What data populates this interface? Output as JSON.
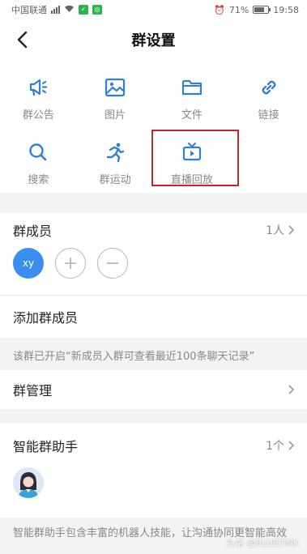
{
  "status_bar": {
    "carrier": "中国联通",
    "alarm": "⏰",
    "battery": "71%",
    "battery_level": 0.71,
    "time": "19:58"
  },
  "navbar": {
    "title": "群设置"
  },
  "features": [
    {
      "label": "群公告",
      "icon": "megaphone-icon"
    },
    {
      "label": "图片",
      "icon": "image-icon"
    },
    {
      "label": "文件",
      "icon": "folder-icon"
    },
    {
      "label": "链接",
      "icon": "link-icon"
    },
    {
      "label": "搜索",
      "icon": "search-icon"
    },
    {
      "label": "群运动",
      "icon": "running-icon"
    },
    {
      "label": "直播回放",
      "icon": "tv-icon"
    }
  ],
  "members": {
    "title": "群成员",
    "count": "1人",
    "user_initials": "xy"
  },
  "add_members": {
    "label": "添加群成员",
    "notice": "该群已开启“新成员入群可查看最近100条聊天记录”"
  },
  "manage": {
    "label": "群管理"
  },
  "assistant": {
    "title": "智能群助手",
    "count": "1个",
    "description": "智能群助手包含丰富的机器人技能，让沟通协同更智能高效"
  },
  "watermark": "头条 @BLUEPINK",
  "colors": {
    "accent": "#2f7fd8",
    "highlight_border": "#c0272d",
    "user_avatar": "#3a8ef0"
  }
}
